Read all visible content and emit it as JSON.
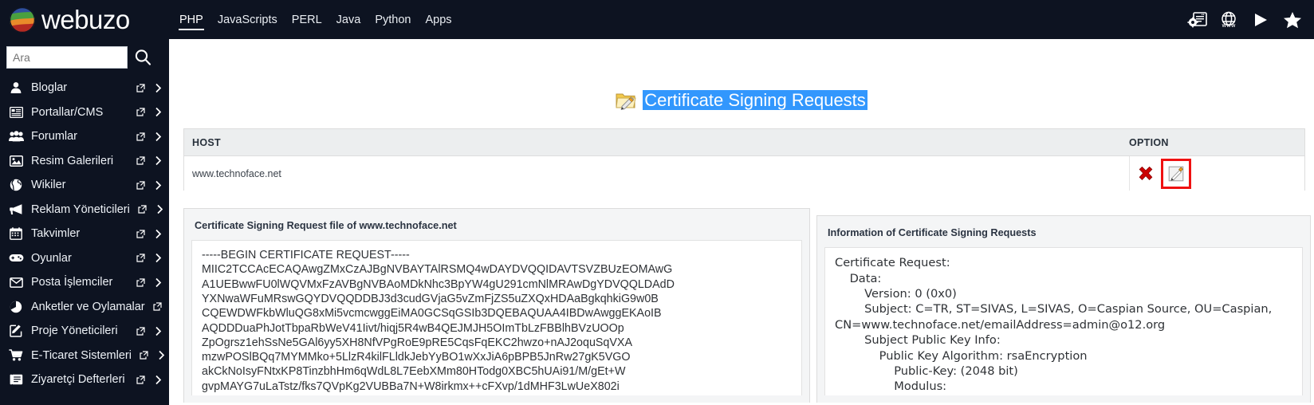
{
  "brand": {
    "name": "webuzo",
    "logo_icon": "webuzo-sphere-logo"
  },
  "topnav": {
    "items": [
      {
        "label": "PHP",
        "active": true
      },
      {
        "label": "JavaScripts",
        "active": false
      },
      {
        "label": "PERL",
        "active": false
      },
      {
        "label": "Java",
        "active": false
      },
      {
        "label": "Python",
        "active": false
      },
      {
        "label": "Apps",
        "active": false
      }
    ],
    "icons": [
      {
        "name": "server-settings-icon"
      },
      {
        "name": "www-globe-icon"
      },
      {
        "name": "play-icon"
      },
      {
        "name": "star-icon"
      }
    ]
  },
  "sidebar": {
    "search": {
      "value": "",
      "placeholder": "Ara",
      "icon": "search-icon"
    },
    "items": [
      {
        "label": "Bloglar",
        "icon": "user-icon"
      },
      {
        "label": "Portallar/CMS",
        "icon": "portal-window-icon"
      },
      {
        "label": "Forumlar",
        "icon": "users-group-icon"
      },
      {
        "label": "Resim Galerileri",
        "icon": "image-icon"
      },
      {
        "label": "Wikiler",
        "icon": "globe-icon"
      },
      {
        "label": "Reklam Yöneticileri",
        "icon": "megaphone-icon"
      },
      {
        "label": "Takvimler",
        "icon": "calendar-icon"
      },
      {
        "label": "Oyunlar",
        "icon": "gamepad-icon"
      },
      {
        "label": "Posta İşlemciler",
        "icon": "envelope-icon"
      },
      {
        "label": "Anketler ve Oylamalar",
        "icon": "pie-chart-icon"
      },
      {
        "label": "Proje Yöneticileri",
        "icon": "edit-square-icon"
      },
      {
        "label": "E-Ticaret Sistemleri",
        "icon": "shopping-cart-icon"
      },
      {
        "label": "Ziyaretçi Defterleri",
        "icon": "guestbook-icon"
      }
    ],
    "row_icons": {
      "external": "external-link-icon",
      "caret": "chevron-right-icon"
    }
  },
  "page": {
    "title": "Certificate Signing Requests",
    "title_icon": "folder-pencil-icon",
    "title_selected": true
  },
  "host_table": {
    "columns": [
      "HOST",
      "OPTION"
    ],
    "rows": [
      {
        "host": "www.technoface.net",
        "actions": [
          {
            "name": "delete-icon",
            "label": ""
          },
          {
            "name": "edit-icon",
            "label": "",
            "highlighted": true
          }
        ]
      }
    ]
  },
  "csr_panel": {
    "title": "Certificate Signing Request file of www.technoface.net",
    "lines": [
      "-----BEGIN CERTIFICATE REQUEST-----",
      "MIIC2TCCAcECAQAwgZMxCzAJBgNVBAYTAlRSMQ4wDAYDVQQIDAVTSVZBUzEOMAwG",
      "A1UEBwwFU0lWQVMxFzAVBgNVBAoMDkNhc3BpYW4gU291cmNlMRAwDgYDVQQLDAdD",
      "YXNwaWFuMRswGQYDVQQDDBJ3d3cudGVjaG5vZmFjZS5uZXQxHDAaBgkqhkiG9w0B",
      "CQEWDWFkbWluQG8xMi5vcmcwggEiMA0GCSqGSIb3DQEBAQUAA4IBDwAwggEKAoIB",
      "AQDDDuaPhJotTbpaRbWeV41Iivt/hiqj5R4wB4QEJMJH5OImTbLzFBBlhBVzUOOp",
      "ZpOgrsz1ehSsNe5GAl6yy5XH8NfVPgRoE9pRE5CqsFqEKC2hwzo+nAJ2oquSqVXA",
      "mzwPOSlBQq7MYMMko+5LlzR4kilFLldkJebYyBO1wXxJiA6pBPB5JnRw27gK5VGO",
      "akCkNoIsyFNtxKP8TinzbhHm6qWdL8L7EebXMm80HTodg0XBC5hUAi91/M/gEt+W",
      "gvpMAYG7uLaTstz/fks7QVpKg2VUBBa7N+W8irkmx++cFXvp/1dMHF3LwUeX802i"
    ]
  },
  "info_panel": {
    "title": "Information of Certificate Signing Requests",
    "lines": [
      "Certificate Request:",
      "    Data:",
      "        Version: 0 (0x0)",
      "        Subject: C=TR, ST=SIVAS, L=SIVAS, O=Caspian Source, OU=Caspian, CN=www.technoface.net/emailAddress=admin@o12.org",
      "        Subject Public Key Info:",
      "            Public Key Algorithm: rsaEncryption",
      "                Public-Key: (2048 bit)",
      "                Modulus:"
    ]
  },
  "colors": {
    "chrome": "#0d1321",
    "selection": "#3297fd",
    "danger": "#ef1111",
    "panel_header": "#eceeef"
  }
}
